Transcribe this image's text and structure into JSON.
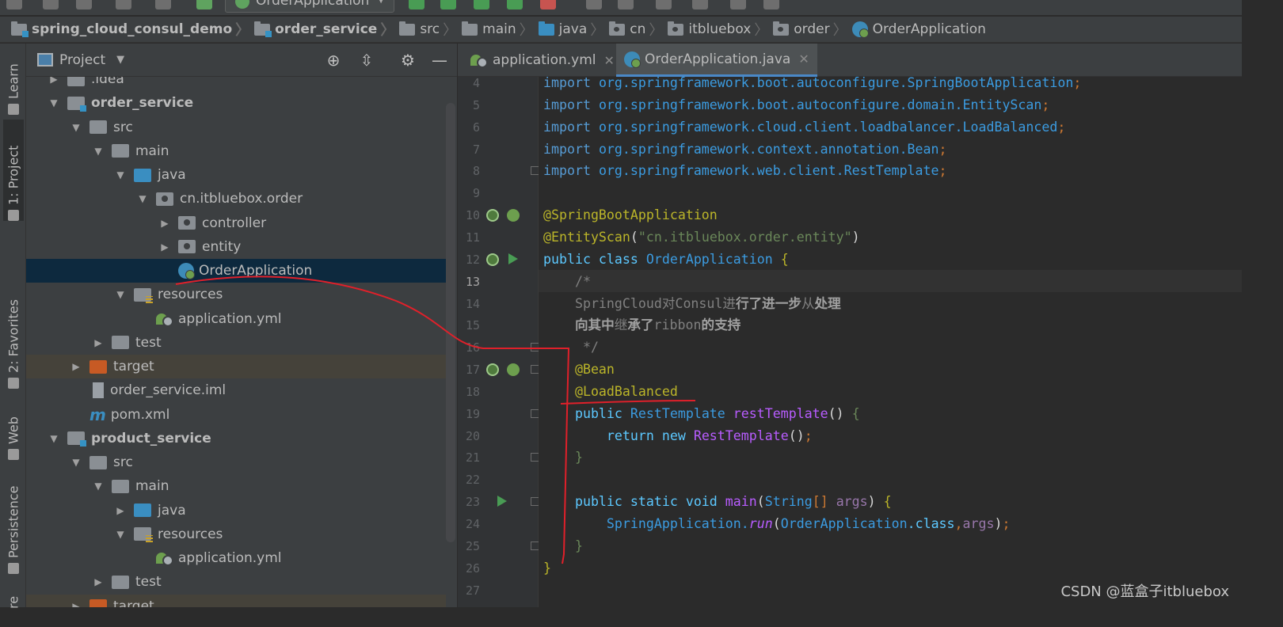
{
  "toolbar": {
    "run_config": "OrderApplication"
  },
  "breadcrumb": [
    {
      "label": "spring_cloud_consul_demo",
      "icon": "module-folder-icon",
      "bold": true
    },
    {
      "label": "order_service",
      "icon": "module-folder-icon",
      "bold": true
    },
    {
      "label": "src",
      "icon": "folder-icon",
      "bold": false
    },
    {
      "label": "main",
      "icon": "folder-icon",
      "bold": false
    },
    {
      "label": "java",
      "icon": "source-folder-icon",
      "bold": false
    },
    {
      "label": "cn",
      "icon": "package-icon",
      "bold": false
    },
    {
      "label": "itbluebox",
      "icon": "package-icon",
      "bold": false
    },
    {
      "label": "order",
      "icon": "package-icon",
      "bold": false
    },
    {
      "label": "OrderApplication",
      "icon": "spring-boot-class-icon",
      "bold": false
    }
  ],
  "left_strip": {
    "learn": "Learn",
    "project": "1: Project",
    "favorites": "2: Favorites",
    "web": "Web",
    "persistence": "Persistence",
    "structure": "re"
  },
  "project_panel": {
    "title": "Project",
    "tree": [
      {
        "label": ".idea",
        "indent": 1,
        "arrow": "right",
        "icon": "folder"
      },
      {
        "label": "order_service",
        "indent": 1,
        "arrow": "down",
        "icon": "module",
        "bold": true
      },
      {
        "label": "src",
        "indent": 2,
        "arrow": "down",
        "icon": "folder"
      },
      {
        "label": "main",
        "indent": 3,
        "arrow": "down",
        "icon": "folder"
      },
      {
        "label": "java",
        "indent": 4,
        "arrow": "down",
        "icon": "src"
      },
      {
        "label": "cn.itbluebox.order",
        "indent": 5,
        "arrow": "down",
        "icon": "pkg"
      },
      {
        "label": "controller",
        "indent": 6,
        "arrow": "right",
        "icon": "pkg"
      },
      {
        "label": "entity",
        "indent": 6,
        "arrow": "right",
        "icon": "pkg"
      },
      {
        "label": "OrderApplication",
        "indent": 6,
        "arrow": "none",
        "icon": "app",
        "selected": true
      },
      {
        "label": "resources",
        "indent": 4,
        "arrow": "down",
        "icon": "res"
      },
      {
        "label": "application.yml",
        "indent": 5,
        "arrow": "none",
        "icon": "yml"
      },
      {
        "label": "test",
        "indent": 3,
        "arrow": "right",
        "icon": "folder"
      },
      {
        "label": "target",
        "indent": 2,
        "arrow": "right",
        "icon": "target",
        "excluded": true
      },
      {
        "label": "order_service.iml",
        "indent": 2,
        "arrow": "none",
        "icon": "iml"
      },
      {
        "label": "pom.xml",
        "indent": 2,
        "arrow": "none",
        "icon": "maven"
      },
      {
        "label": "product_service",
        "indent": 1,
        "arrow": "down",
        "icon": "module",
        "bold": true
      },
      {
        "label": "src",
        "indent": 2,
        "arrow": "down",
        "icon": "folder"
      },
      {
        "label": "main",
        "indent": 3,
        "arrow": "down",
        "icon": "folder"
      },
      {
        "label": "java",
        "indent": 4,
        "arrow": "right",
        "icon": "src"
      },
      {
        "label": "resources",
        "indent": 4,
        "arrow": "down",
        "icon": "res"
      },
      {
        "label": "application.yml",
        "indent": 5,
        "arrow": "none",
        "icon": "yml"
      },
      {
        "label": "test",
        "indent": 3,
        "arrow": "right",
        "icon": "folder"
      },
      {
        "label": "target",
        "indent": 2,
        "arrow": "right",
        "icon": "target",
        "excluded": true
      }
    ]
  },
  "editor_tabs": [
    {
      "label": "application.yml",
      "active": false
    },
    {
      "label": "OrderApplication.java",
      "active": true
    }
  ],
  "code": {
    "current_line": 13,
    "lines": [
      {
        "n": "4",
        "tokens": [
          [
            "kw-b",
            "import "
          ],
          [
            "pkg",
            "org.springframework.boot.autoconfigure.SpringBootApplication"
          ],
          [
            "kw",
            ";"
          ]
        ]
      },
      {
        "n": "5",
        "tokens": [
          [
            "kw-b",
            "import "
          ],
          [
            "pkg",
            "org.springframework.boot.autoconfigure.domain.EntityScan"
          ],
          [
            "kw",
            ";"
          ]
        ]
      },
      {
        "n": "6",
        "tokens": [
          [
            "kw-b",
            "import "
          ],
          [
            "pkg",
            "org.springframework.cloud.client.loadbalancer.LoadBalanced"
          ],
          [
            "kw",
            ";"
          ]
        ]
      },
      {
        "n": "7",
        "tokens": [
          [
            "kw-b",
            "import "
          ],
          [
            "pkg",
            "org.springframework.context.annotation.Bean"
          ],
          [
            "kw",
            ";"
          ]
        ]
      },
      {
        "n": "8",
        "tokens": [
          [
            "kw-b",
            "import "
          ],
          [
            "pkg",
            "org.springframework.web.client.RestTemplate"
          ],
          [
            "kw",
            ";"
          ]
        ]
      },
      {
        "n": "9",
        "tokens": []
      },
      {
        "n": "10",
        "tokens": [
          [
            "ann",
            "@SpringBootApplication"
          ]
        ]
      },
      {
        "n": "11",
        "tokens": [
          [
            "ann",
            "@EntityScan"
          ],
          [
            "plain",
            "("
          ],
          [
            "str",
            "\"cn.itbluebox.order.entity\""
          ],
          [
            "plain",
            ")"
          ]
        ]
      },
      {
        "n": "12",
        "tokens": [
          [
            "pub",
            "public class "
          ],
          [
            "cls",
            "OrderApplication "
          ],
          [
            "ann",
            "{"
          ]
        ]
      },
      {
        "n": "13",
        "tokens": [
          [
            "cmt",
            "    /*"
          ]
        ]
      },
      {
        "n": "14",
        "tokens": [
          [
            "cmt",
            "    SpringCloud对Consul进"
          ],
          [
            "cmtb",
            "行了进一步"
          ],
          [
            "cmt",
            "从"
          ],
          [
            "cmtb",
            "处理"
          ]
        ]
      },
      {
        "n": "15",
        "tokens": [
          [
            "cmtb",
            "    向其中"
          ],
          [
            "cmt",
            "继"
          ],
          [
            "cmtb",
            "承了"
          ],
          [
            "cmt",
            "ribbon"
          ],
          [
            "cmtb",
            "的支持"
          ]
        ]
      },
      {
        "n": "16",
        "tokens": [
          [
            "cmt",
            "     */"
          ]
        ]
      },
      {
        "n": "17",
        "tokens": [
          [
            "ann",
            "    @Bean"
          ]
        ]
      },
      {
        "n": "18",
        "tokens": [
          [
            "ann",
            "    @LoadBalanced"
          ]
        ]
      },
      {
        "n": "19",
        "tokens": [
          [
            "pub",
            "    public "
          ],
          [
            "cls",
            "RestTemplate "
          ],
          [
            "fn",
            "restTemplate"
          ],
          [
            "plain",
            "() "
          ],
          [
            "str",
            "{"
          ]
        ]
      },
      {
        "n": "20",
        "tokens": [
          [
            "pub",
            "        return new "
          ],
          [
            "fn",
            "RestTemplate"
          ],
          [
            "plain",
            "()"
          ],
          [
            "kw",
            ";"
          ]
        ]
      },
      {
        "n": "21",
        "tokens": [
          [
            "str",
            "    }"
          ]
        ]
      },
      {
        "n": "22",
        "tokens": []
      },
      {
        "n": "23",
        "tokens": [
          [
            "pub",
            "    public static void "
          ],
          [
            "fn",
            "main"
          ],
          [
            "plain",
            "("
          ],
          [
            "cls",
            "String"
          ],
          [
            "kw",
            "[] "
          ],
          [
            "argc",
            "args"
          ],
          [
            "plain",
            ") "
          ],
          [
            "ann",
            "{"
          ]
        ]
      },
      {
        "n": "24",
        "tokens": [
          [
            "cls",
            "        SpringApplication."
          ],
          [
            "fn",
            "run"
          ],
          [
            "plain",
            "("
          ],
          [
            "cls",
            "OrderApplication"
          ],
          [
            "pub",
            ".class"
          ],
          [
            "kw",
            ","
          ],
          [
            "argc",
            "args"
          ],
          [
            "plain",
            ")"
          ],
          [
            "kw",
            ";"
          ]
        ]
      },
      {
        "n": "25",
        "tokens": [
          [
            "str",
            "    }"
          ]
        ]
      },
      {
        "n": "26",
        "tokens": [
          [
            "ann",
            "}"
          ]
        ]
      },
      {
        "n": "27",
        "tokens": []
      }
    ]
  },
  "watermark": "CSDN @蓝盒子itbluebox",
  "colors": {
    "annotation_ink": "#e0202a",
    "selection": "#0d293e",
    "accent": "#4a88c7"
  }
}
